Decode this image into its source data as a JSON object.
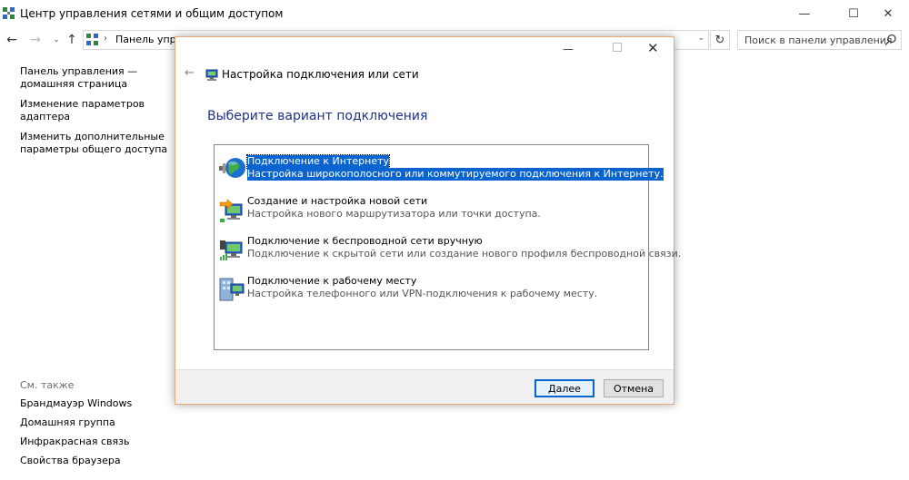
{
  "window": {
    "title": "Центр управления сетями и общим доступом",
    "min_glyph": "—",
    "max_glyph": "☐",
    "close_glyph": "✕"
  },
  "nav": {
    "back_glyph": "←",
    "forward_glyph": "→",
    "recent_glyph": "⌄",
    "up_glyph": "↑",
    "address_sep": "›",
    "address_text": "Панель управ…",
    "address_dd": "⌄",
    "refresh_glyph": "↻",
    "search_placeholder": "Поиск в панели управления"
  },
  "left_pane": {
    "links": [
      "Панель управления —\nдомашняя страница",
      "Изменение параметров\nадаптера",
      "Изменить дополнительные\nпараметры общего доступа"
    ],
    "see_also_title": "См. также",
    "see_also": [
      "Брандмауэр Windows",
      "Домашняя группа",
      "Инфракрасная связь",
      "Свойства браузера"
    ]
  },
  "dialog": {
    "close_glyph": "✕",
    "min_glyph": "—",
    "back_glyph": "←",
    "title": "Настройка подключения или сети",
    "heading": "Выберите вариант подключения",
    "options": [
      {
        "title": "Подключение к Интернету",
        "desc": "Настройка широкополосного или коммутируемого подключения к Интернету.",
        "icon": "globe-icon",
        "selected": true
      },
      {
        "title": "Создание и настройка новой сети",
        "desc": "Настройка нового маршрутизатора или точки доступа.",
        "icon": "new-network-icon",
        "selected": false
      },
      {
        "title": "Подключение к беспроводной сети вручную",
        "desc": "Подключение к скрытой сети или создание нового профиля беспроводной связи.",
        "icon": "wireless-icon",
        "selected": false
      },
      {
        "title": "Подключение к рабочему месту",
        "desc": "Настройка телефонного или VPN-подключения к рабочему месту.",
        "icon": "workplace-icon",
        "selected": false
      }
    ],
    "next_label": "Далее",
    "cancel_label": "Отмена"
  },
  "colors": {
    "selection": "#0a64d0",
    "heading": "#1e3287",
    "dialog_border": "#e8a878"
  }
}
